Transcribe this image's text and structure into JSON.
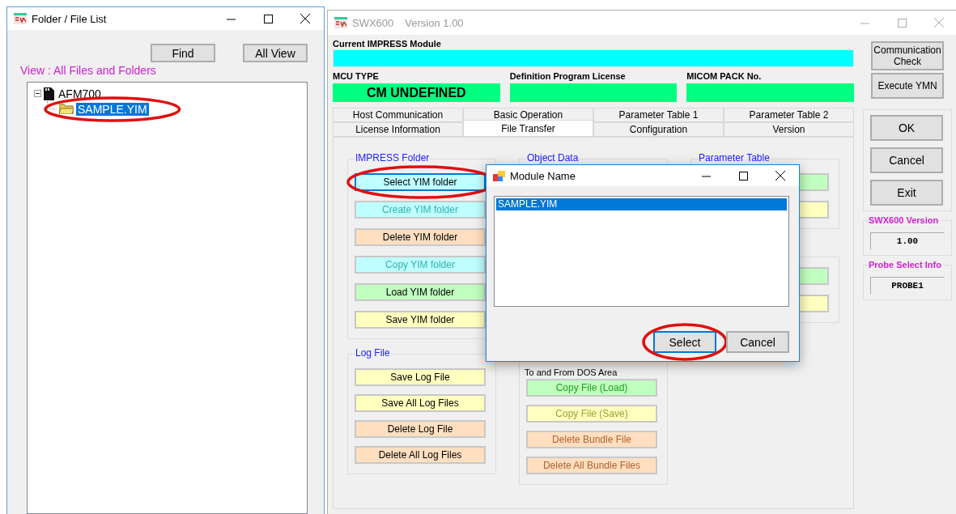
{
  "folder_window": {
    "title": "Folder / File List",
    "buttons": [
      "Find",
      "All View"
    ],
    "view_label": "View : All Files and Folders",
    "tree": [
      {
        "label": "AFM700",
        "expanded": true,
        "selected": false,
        "circled": false,
        "children": [
          {
            "label": "SAMPLE.YIM",
            "selected": true,
            "circled": true
          }
        ]
      }
    ]
  },
  "main_window": {
    "title": "SWX600",
    "version": "Version  1.00",
    "module_label": "Current IMPRESS Module",
    "info_fields": [
      {
        "label": "MCU TYPE",
        "value": "CM UNDEFINED"
      },
      {
        "label": "Definition Program License"
      },
      {
        "label": "MICOM PACK No."
      }
    ],
    "tab_rows": [
      [
        {
          "label": "Host Communication",
          "selected": false
        },
        {
          "label": "Basic Operation",
          "selected": false
        },
        {
          "label": "Parameter Table 1",
          "selected": false
        },
        {
          "label": "Parameter Table 2",
          "selected": false
        }
      ],
      [
        {
          "label": "License Information",
          "selected": false
        },
        {
          "label": "File Transfer",
          "selected": true
        },
        {
          "label": "Configuration",
          "selected": false
        },
        {
          "label": "Version",
          "selected": false
        }
      ]
    ],
    "top_columns": [
      {
        "groups": [
          {
            "title": "IMPRESS Folder",
            "buttons": [
              {
                "label": "Select YIM folder",
                "kind": "cyan",
                "disabled": false,
                "focused": true,
                "circled": true
              },
              {
                "label": "Create YIM folder",
                "kind": "cyan",
                "disabled": true,
                "focused": false,
                "circled": false
              },
              {
                "label": "Delete YIM folder",
                "kind": "peach",
                "disabled": false,
                "focused": false,
                "circled": false
              },
              {
                "label": "Copy YIM folder",
                "kind": "cyan",
                "disabled": true,
                "focused": false,
                "circled": false
              },
              {
                "label": "Load YIM folder",
                "kind": "green",
                "disabled": false,
                "focused": false,
                "circled": false
              },
              {
                "label": "Save YIM folder",
                "kind": "yellow",
                "disabled": false,
                "focused": false,
                "circled": false
              }
            ]
          }
        ]
      },
      {
        "groups": [
          {
            "title": "Object Data"
          }
        ]
      },
      {
        "groups": [
          {
            "title": "Parameter Table",
            "buttons": [
              {
                "kind": "green"
              },
              {
                "kind": "yellow"
              }
            ]
          },
          {
            "buttons": [
              {
                "kind": "green"
              },
              {
                "kind": "yellow"
              }
            ]
          }
        ]
      }
    ],
    "bottom_columns": [
      {
        "groups": [
          {
            "title": "Log File",
            "buttons": [
              {
                "label": "Save Log File",
                "kind": "yellow",
                "disabled": false,
                "focused": false,
                "circled": false
              },
              {
                "label": "Save All Log Files",
                "kind": "yellow",
                "disabled": false,
                "focused": false,
                "circled": false
              },
              {
                "label": "Delete Log File",
                "kind": "peach",
                "disabled": false,
                "focused": false,
                "circled": false
              },
              {
                "label": "Delete All Log Files",
                "kind": "peach",
                "disabled": false,
                "focused": false,
                "circled": false
              }
            ]
          }
        ]
      },
      {
        "groups": [
          {
            "caption": "To and From DOS Area",
            "buttons": [
              {
                "label": "Copy File (Load)",
                "kind": "green",
                "disabled": true,
                "focused": false,
                "circled": false
              },
              {
                "label": "Copy File (Save)",
                "kind": "yellow",
                "disabled": true,
                "focused": false,
                "circled": false
              },
              {
                "label": "Delete Bundle File",
                "kind": "peach",
                "disabled": true,
                "focused": false,
                "circled": false
              },
              {
                "label": "Delete All Bundle Files",
                "kind": "peach",
                "disabled": true,
                "focused": false,
                "circled": false
              }
            ]
          }
        ]
      }
    ],
    "side_buttons": [
      "Communication Check",
      "Execute YMN"
    ],
    "action_buttons": [
      "OK",
      "Cancel",
      "Exit"
    ],
    "info_boxes": [
      {
        "title": "SWX600 Version",
        "value": "1.00"
      },
      {
        "title": "Probe Select Info",
        "value": "PROBE1"
      }
    ]
  },
  "dialog": {
    "title": "Module Name",
    "items": [
      {
        "label": "SAMPLE.YIM",
        "selected": true
      }
    ],
    "buttons": [
      {
        "label": "Select",
        "default": true,
        "circled": true
      },
      {
        "label": "Cancel",
        "default": false,
        "circled": false
      }
    ]
  }
}
